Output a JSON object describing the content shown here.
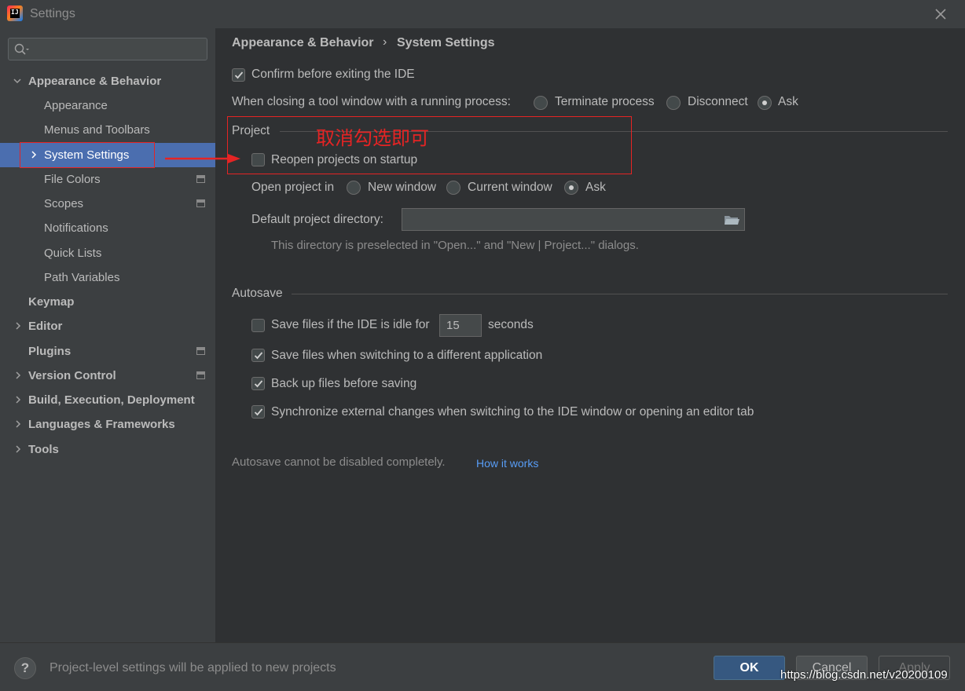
{
  "window": {
    "title": "Settings"
  },
  "search": {
    "placeholder": ""
  },
  "sidebar": {
    "items": [
      {
        "label": "Appearance & Behavior"
      },
      {
        "label": "Appearance"
      },
      {
        "label": "Menus and Toolbars"
      },
      {
        "label": "System Settings"
      },
      {
        "label": "File Colors"
      },
      {
        "label": "Scopes"
      },
      {
        "label": "Notifications"
      },
      {
        "label": "Quick Lists"
      },
      {
        "label": "Path Variables"
      },
      {
        "label": "Keymap"
      },
      {
        "label": "Editor"
      },
      {
        "label": "Plugins"
      },
      {
        "label": "Version Control"
      },
      {
        "label": "Build, Execution, Deployment"
      },
      {
        "label": "Languages & Frameworks"
      },
      {
        "label": "Tools"
      }
    ]
  },
  "breadcrumb": {
    "parent": "Appearance & Behavior",
    "separator": "›",
    "current": "System Settings"
  },
  "general": {
    "confirm_exit": {
      "label": "Confirm before exiting the IDE",
      "checked": true
    },
    "closing_tool_window": {
      "label": "When closing a tool window with a running process:",
      "options": [
        "Terminate process",
        "Disconnect",
        "Ask"
      ],
      "selected": "Ask"
    }
  },
  "project": {
    "section_title": "Project",
    "reopen": {
      "label": "Reopen projects on startup",
      "checked": false
    },
    "open_in": {
      "label": "Open project in",
      "options": [
        "New window",
        "Current window",
        "Ask"
      ],
      "selected": "Ask"
    },
    "default_dir": {
      "label": "Default project directory:",
      "value": ""
    },
    "hint": "This directory is preselected in \"Open...\" and \"New | Project...\" dialogs."
  },
  "autosave": {
    "section_title": "Autosave",
    "idle": {
      "label": "Save files if the IDE is idle for",
      "value": "15",
      "unit": "seconds",
      "checked": false
    },
    "switch_app": {
      "label": "Save files when switching to a different application",
      "checked": true
    },
    "backup": {
      "label": "Back up files before saving",
      "checked": true
    },
    "sync": {
      "label": "Synchronize external changes when switching to the IDE window or opening an editor tab",
      "checked": true
    },
    "note": "Autosave cannot be disabled completely.",
    "note_link": "How it works"
  },
  "annotation": {
    "text": "取消勾选即可",
    "color": "#e52424"
  },
  "footer": {
    "help_label": "?",
    "message": "Project-level settings will be applied to new projects",
    "ok_label": "OK",
    "cancel_label": "Cancel",
    "apply_label": "Apply"
  },
  "watermark": "https://blog.csdn.net/v20200109",
  "colors": {
    "selection": "#4b6eaf",
    "link": "#589df6",
    "annotation": "#e52424"
  }
}
